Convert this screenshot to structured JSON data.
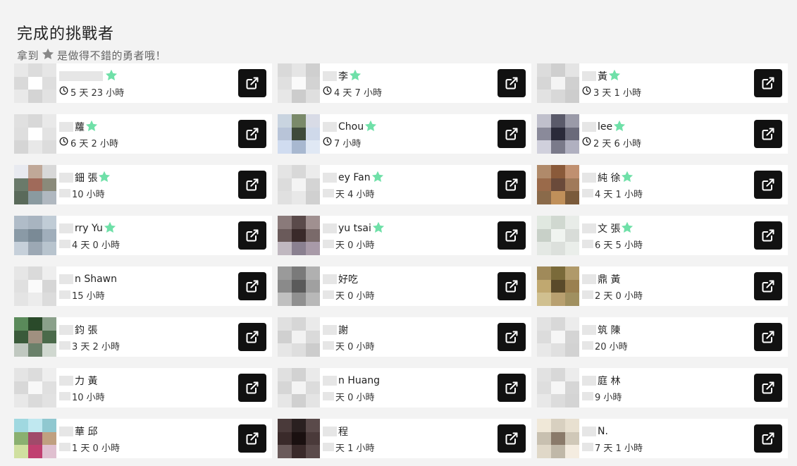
{
  "header": {
    "title": "完成的挑戰者",
    "subtitle_prefix": "拿到",
    "subtitle_suffix": "是做得不錯的勇者哦！"
  },
  "colors": {
    "star": "#6fe0a8",
    "star_gray": "#888888",
    "button": "#111111"
  },
  "challengers": [
    {
      "name": "",
      "time": "5 天 23 小時",
      "star": true,
      "clock": true
    },
    {
      "name": "李",
      "time": "4 天 7 小時",
      "star": true,
      "clock": true
    },
    {
      "name": "黃",
      "time": "3 天 1 小時",
      "star": true,
      "clock": true
    },
    {
      "name": "蘿",
      "time": "6 天 2 小時",
      "star": true,
      "clock": true
    },
    {
      "name": "Chou",
      "time": "7 小時",
      "star": true,
      "clock": true
    },
    {
      "name": "lee",
      "time": "2 天 6 小時",
      "star": true,
      "clock": true
    },
    {
      "name": "鈿 張",
      "time": "10 小時",
      "star": true,
      "clock": false
    },
    {
      "name": "ey Fan",
      "time": "天 4 小時",
      "star": true,
      "clock": false
    },
    {
      "name": "純 徐",
      "time": "4 天 1 小時",
      "star": true,
      "clock": false
    },
    {
      "name": "rry Yu",
      "time": "4 天 0 小時",
      "star": true,
      "clock": false
    },
    {
      "name": "yu tsai",
      "time": "天 0 小時",
      "star": true,
      "clock": false
    },
    {
      "name": "文 張",
      "time": "6 天 5 小時",
      "star": true,
      "clock": false
    },
    {
      "name": "n Shawn",
      "time": "15 小時",
      "star": false,
      "clock": false
    },
    {
      "name": "好吃",
      "time": "天 0 小時",
      "star": false,
      "clock": false
    },
    {
      "name": "鼎 黃",
      "time": "2 天 0 小時",
      "star": false,
      "clock": false
    },
    {
      "name": "鈞 張",
      "time": "3 天 2 小時",
      "star": false,
      "clock": false
    },
    {
      "name": "謝",
      "time": "天 0 小時",
      "star": false,
      "clock": false
    },
    {
      "name": "筑 陳",
      "time": "20 小時",
      "star": false,
      "clock": false
    },
    {
      "name": "力 黃",
      "time": "10 小時",
      "star": false,
      "clock": false
    },
    {
      "name": "n Huang",
      "time": "天 0 小時",
      "star": false,
      "clock": false
    },
    {
      "name": "庭 林",
      "time": "9 小時",
      "star": false,
      "clock": false
    },
    {
      "name": "華 邱",
      "time": "1 天 0 小時",
      "star": false,
      "clock": false
    },
    {
      "name": "程",
      "time": "天 1 小時",
      "star": false,
      "clock": false
    },
    {
      "name": "N.",
      "time": "7 天 1 小時",
      "star": false,
      "clock": false
    }
  ]
}
